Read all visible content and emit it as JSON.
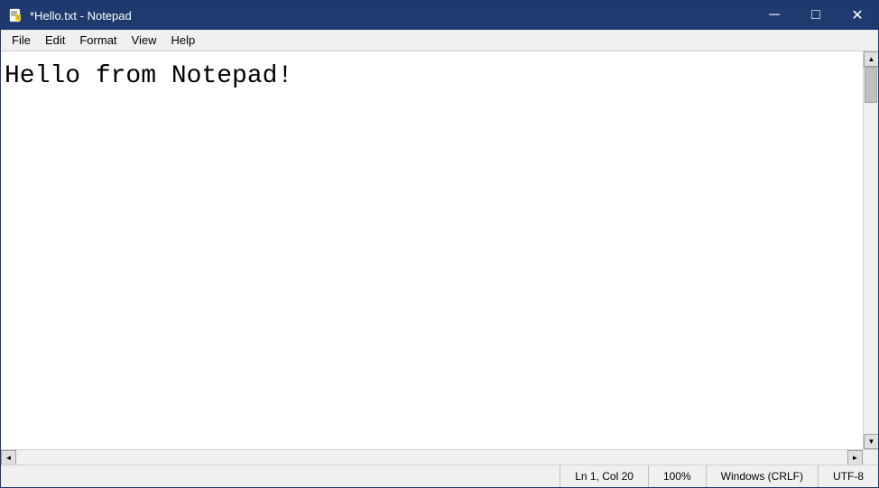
{
  "window": {
    "title": "*Hello.txt - Notepad",
    "icon": "📄"
  },
  "title_controls": {
    "minimize": "─",
    "maximize": "□",
    "close": "✕"
  },
  "menu": {
    "items": [
      "File",
      "Edit",
      "Format",
      "View",
      "Help"
    ]
  },
  "editor": {
    "content": "Hello from Notepad!"
  },
  "status_bar": {
    "position": "Ln 1, Col 20",
    "zoom": "100%",
    "line_ending": "Windows (CRLF)",
    "encoding": "UTF-8"
  },
  "scrollbar": {
    "up_arrow": "▲",
    "down_arrow": "▼",
    "left_arrow": "◄",
    "right_arrow": "►"
  }
}
